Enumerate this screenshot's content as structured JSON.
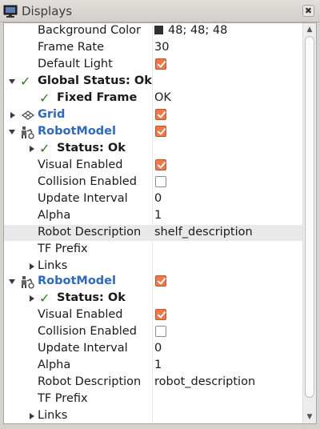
{
  "title": "Displays",
  "close_label": "✖",
  "scroll_up": "▲",
  "scroll_down": "▼",
  "swatch_color": "#303030",
  "accent": "#f07746",
  "link_color": "#2c6ac5",
  "status_ok_color": "#2e7d1e",
  "rows": {
    "background_color": {
      "label": "Background Color",
      "value": "48; 48; 48"
    },
    "frame_rate": {
      "label": "Frame Rate",
      "value": "30"
    },
    "default_light": {
      "label": "Default Light",
      "checked": true
    },
    "global_status": {
      "label": "Global Status: Ok"
    },
    "fixed_frame": {
      "label": "Fixed Frame",
      "value": "OK"
    },
    "grid": {
      "label": "Grid",
      "checked": true
    },
    "robot1": {
      "label": "RobotModel",
      "checked": true
    },
    "r1_status": {
      "label": "Status: Ok"
    },
    "r1_visual": {
      "label": "Visual Enabled",
      "checked": true
    },
    "r1_collision": {
      "label": "Collision Enabled",
      "checked": false
    },
    "r1_update": {
      "label": "Update Interval",
      "value": "0"
    },
    "r1_alpha": {
      "label": "Alpha",
      "value": "1"
    },
    "r1_desc": {
      "label": "Robot Description",
      "value": "shelf_description"
    },
    "r1_tf": {
      "label": "TF Prefix",
      "value": ""
    },
    "r1_links": {
      "label": "Links"
    },
    "robot2": {
      "label": "RobotModel",
      "checked": true
    },
    "r2_status": {
      "label": "Status: Ok"
    },
    "r2_visual": {
      "label": "Visual Enabled",
      "checked": true
    },
    "r2_collision": {
      "label": "Collision Enabled",
      "checked": false
    },
    "r2_update": {
      "label": "Update Interval",
      "value": "0"
    },
    "r2_alpha": {
      "label": "Alpha",
      "value": "1"
    },
    "r2_desc": {
      "label": "Robot Description",
      "value": "robot_description"
    },
    "r2_tf": {
      "label": "TF Prefix",
      "value": ""
    },
    "r2_links": {
      "label": "Links"
    }
  }
}
